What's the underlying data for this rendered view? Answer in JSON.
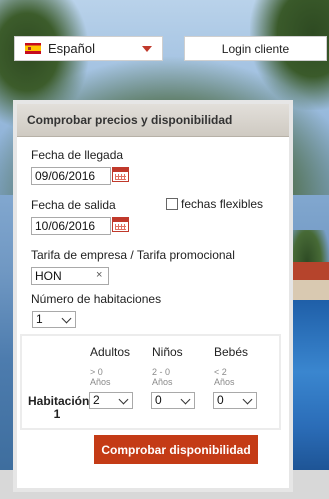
{
  "language": {
    "label": "Español"
  },
  "login": {
    "label": "Login cliente"
  },
  "panel": {
    "title": "Comprobar precios y disponibilidad",
    "arrival": {
      "label": "Fecha de llegada",
      "value": "09/06/2016"
    },
    "departure": {
      "label": "Fecha de salida",
      "value": "10/06/2016"
    },
    "flexible": {
      "label": "fechas flexibles",
      "checked": false
    },
    "promo": {
      "label": "Tarifa de empresa / Tarifa promocional",
      "value": "HON",
      "clear": "×"
    },
    "rooms": {
      "label": "Número de habitaciones",
      "value": "1"
    },
    "occupancy": {
      "adults": {
        "label": "Adultos",
        "range": "> 0",
        "unit": "Años",
        "value": "2"
      },
      "children": {
        "label": "Niños",
        "range": "2 - 0",
        "unit": "Años",
        "value": "0"
      },
      "babies": {
        "label": "Bebés",
        "range": "< 2",
        "unit": "Años",
        "value": "0"
      },
      "room_label_line1": "Habitación",
      "room_label_line2": "1"
    },
    "submit": "Comprobar disponibilidad"
  }
}
